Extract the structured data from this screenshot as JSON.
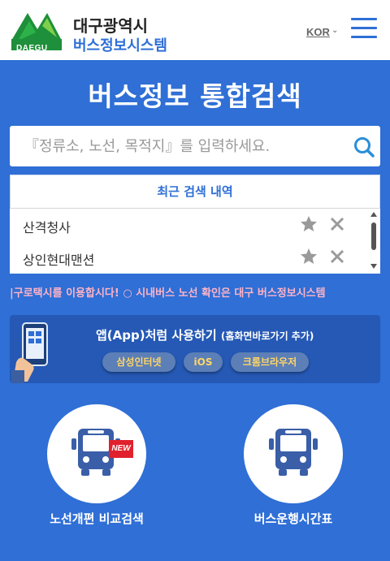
{
  "header": {
    "logo_text": "DAEGU",
    "city_name": "대구광역시",
    "system_name": "버스정보시스템",
    "language": "KOR"
  },
  "main": {
    "title": "버스정보 통합검색"
  },
  "search": {
    "placeholder": "『정류소, 노선, 목적지』를 입력하세요.",
    "value": ""
  },
  "recent": {
    "header": "최근 검색 내역",
    "items": [
      {
        "label": "산격청사"
      },
      {
        "label": "상인현대맨션"
      }
    ]
  },
  "ticker": {
    "text": "|구로택시를 이용합시다!  ○ 시내버스 노선 확인은 대구 버스정보시스템"
  },
  "app_banner": {
    "title": "앱(App)처럼 사용하기",
    "subtitle": "(홈화면바로가기 추가)",
    "buttons": [
      {
        "label": "삼성인터넷"
      },
      {
        "label": "iOS"
      },
      {
        "label": "크롬브라우저"
      }
    ]
  },
  "shortcuts": [
    {
      "label": "노선개편 비교검색",
      "badge": "NEW"
    },
    {
      "label": "버스운행시간표"
    }
  ],
  "colors": {
    "primary_blue": "#2f6fd6",
    "banner_blue": "#2559b5",
    "ticker_pink": "#ffb3c6",
    "badge_red": "#e0212d",
    "logo_green": "#1e8f3a"
  },
  "icons": {
    "menu": "hamburger-icon",
    "search": "search-icon",
    "favorite": "star-icon",
    "delete": "close-icon",
    "bus": "bus-icon"
  }
}
